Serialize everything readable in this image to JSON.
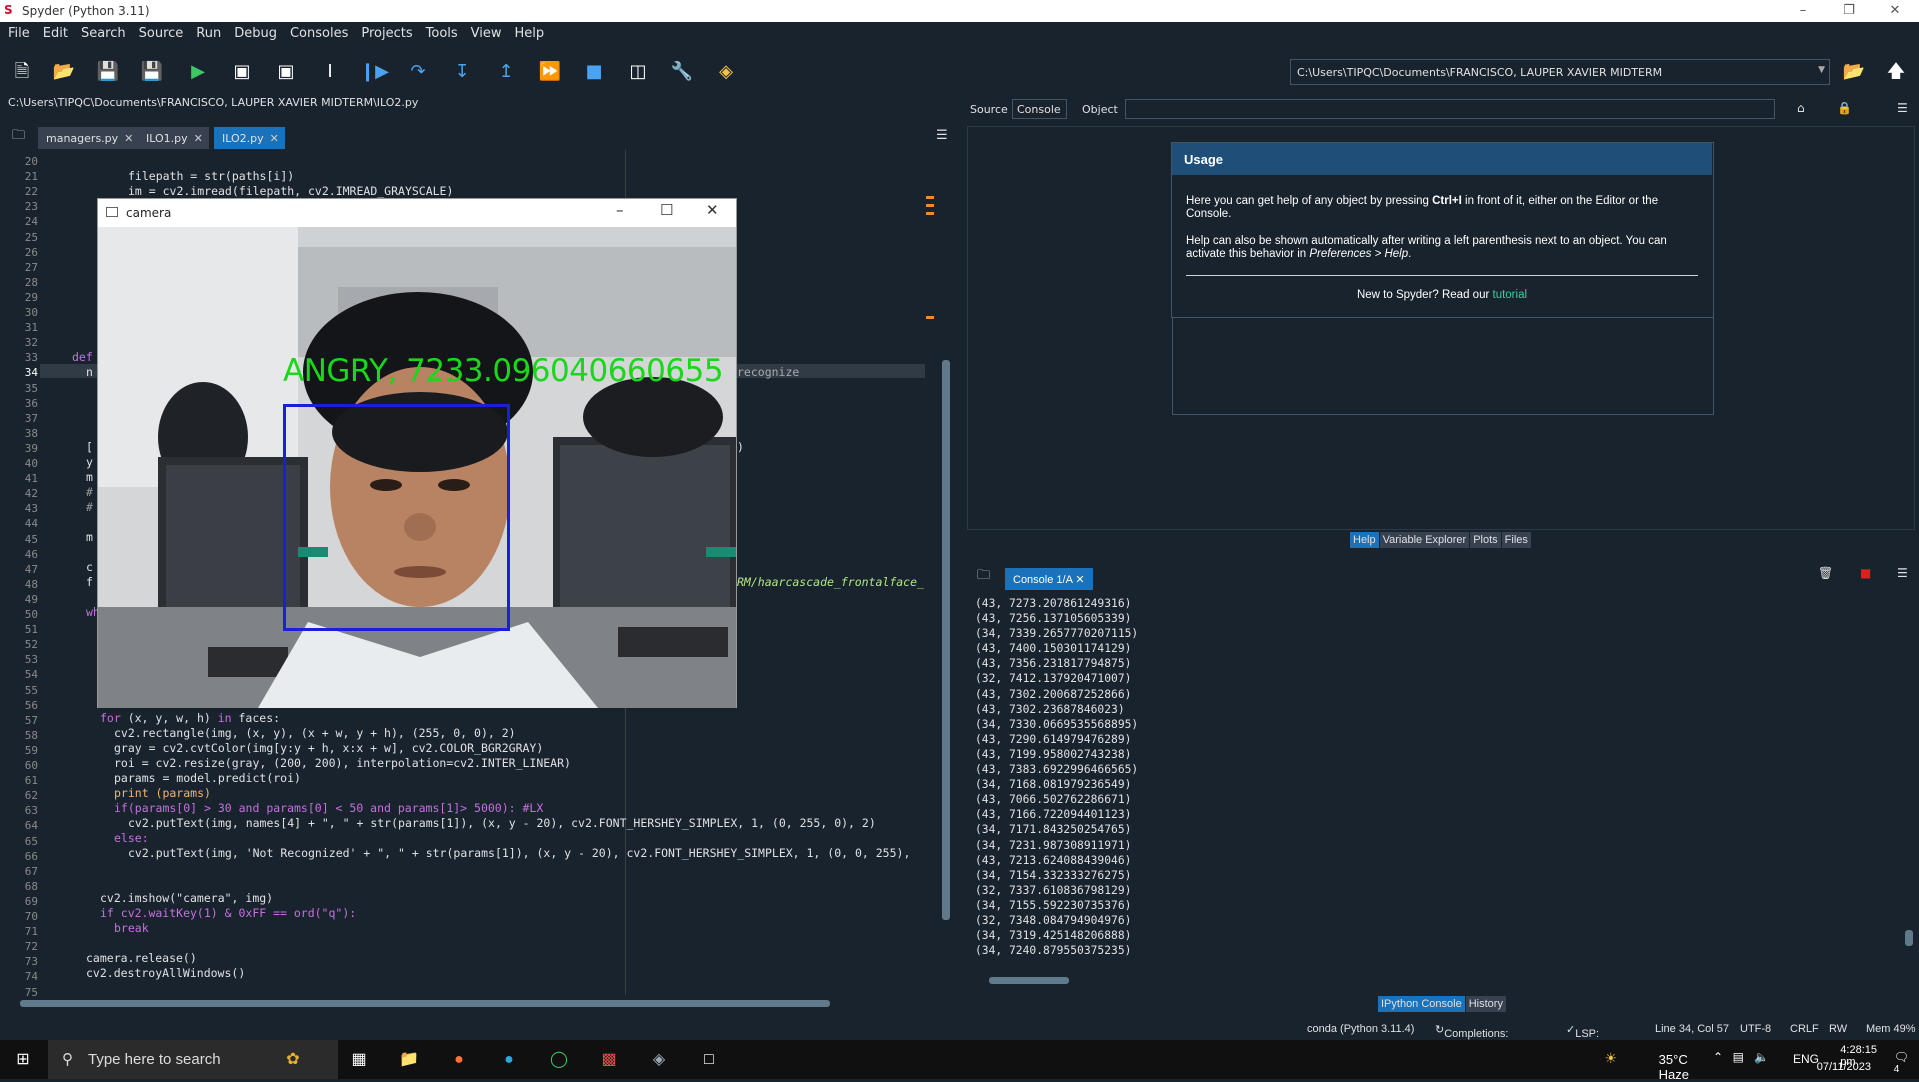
{
  "window": {
    "title": "Spyder (Python 3.11)",
    "minimize": "–",
    "restore": "❐",
    "close": "✕"
  },
  "menu": [
    "File",
    "Edit",
    "Search",
    "Source",
    "Run",
    "Debug",
    "Consoles",
    "Projects",
    "Tools",
    "View",
    "Help"
  ],
  "toolbar": {
    "path": "C:\\Users\\TIPQC\\Documents\\FRANCISCO, LAUPER XAVIER MIDTERM"
  },
  "editor": {
    "filepath": "C:\\Users\\TIPQC\\Documents\\FRANCISCO, LAUPER XAVIER MIDTERM\\ILO2.py",
    "tabs": [
      {
        "label": "managers.py"
      },
      {
        "label": "ILO1.py"
      },
      {
        "label": "ILO2.py"
      }
    ],
    "line_numbers": [
      "20",
      "21",
      "22",
      "23",
      "24",
      "25",
      "26",
      "27",
      "28",
      "29",
      "30",
      "31",
      "32",
      "33",
      "34",
      "35",
      "36",
      "37",
      "38",
      "39",
      "40",
      "41",
      "42",
      "43",
      "44",
      "45",
      "46",
      "47",
      "48",
      "49",
      "50",
      "51",
      "52",
      "53",
      "54",
      "55",
      "56",
      "57",
      "58",
      "59",
      "60",
      "61",
      "62",
      "63",
      "64",
      "65",
      "66",
      "67",
      "68",
      "69",
      "70",
      "71",
      "72",
      "73",
      "74",
      "75"
    ],
    "visible_fragments": {
      "l21": "filepath = str(paths[i])",
      "l22": "im = cv2.imread(filepath, cv2.IMREAD_GRAYSCALE)",
      "l33": "def",
      "l34": "n",
      "l34_right": "recognize",
      "l39": "[",
      "l39_right": ")",
      "l40": "y",
      "l41": "m",
      "l42": "#",
      "l43": "#",
      "l45": "m",
      "l47": "c",
      "l48": "f",
      "l48_right": "RM/haarcascade_frontalface_",
      "l50": "wh",
      "l57": "for (x, y, w, h) in faces:",
      "l58": "cv2.rectangle(img, (x, y), (x + w, y + h), (255, 0, 0), 2)",
      "l59": "gray = cv2.cvtColor(img[y:y + h, x:x + w], cv2.COLOR_BGR2GRAY)",
      "l60": "roi = cv2.resize(gray, (200, 200), interpolation=cv2.INTER_LINEAR)",
      "l61": "params = model.predict(roi)",
      "l62": "print (params)",
      "l63": "if(params[0] > 30 and params[0] < 50 and params[1]> 5000): #LX",
      "l64": "cv2.putText(img, names[4] + \", \" + str(params[1]), (x, y - 20), cv2.FONT_HERSHEY_SIMPLEX, 1, (0, 255, 0), 2)",
      "l65": "else:",
      "l66": "cv2.putText(img, 'Not Recognized' + \", \" + str(params[1]), (x, y - 20), cv2.FONT_HERSHEY_SIMPLEX, 1, (0, 0, 255),",
      "l69": "cv2.imshow(\"camera\", img)",
      "l70": "if cv2.waitKey(1) & 0xFF == ord(\"q\"):",
      "l71": "break",
      "l73": "camera.release()",
      "l74": "cv2.destroyAllWindows()"
    }
  },
  "camera_window": {
    "title": "camera",
    "overlay_label": "ANGRY, 7233.096040660655"
  },
  "help": {
    "source_label": "Source",
    "source_value": "Console",
    "object_label": "Object",
    "usage_title": "Usage",
    "usage_p1_a": "Here you can get help of any object by pressing ",
    "usage_p1_key": "Ctrl+I",
    "usage_p1_b": " in front of it, either on the Editor or the Console.",
    "usage_p2_a": "Help can also be shown automatically after writing a left parenthesis next to an object. You can activate this behavior in ",
    "usage_p2_pref": "Preferences > Help",
    "usage_p2_b": ".",
    "usage_new": "New to Spyder? Read our ",
    "usage_link": "tutorial",
    "pane_tabs": [
      "Help",
      "Variable Explorer",
      "Plots",
      "Files"
    ]
  },
  "console": {
    "tab_label": "Console 1/A",
    "lines": [
      "(43, 7273.207861249316)",
      "(43, 7256.137105605339)",
      "(34, 7339.2657770207115)",
      "(43, 7400.150301174129)",
      "(43, 7356.231817794875)",
      "(32, 7412.137920471007)",
      "(43, 7302.200687252866)",
      "(43, 7302.23687846023)",
      "(34, 7330.0669535568895)",
      "(43, 7290.614979476289)",
      "(43, 7199.958002743238)",
      "(43, 7383.6922996466565)",
      "(34, 7168.081979236549)",
      "(43, 7066.502762286671)",
      "(43, 7166.722094401123)",
      "(34, 7171.843250254765)",
      "(34, 7231.987308911971)",
      "(43, 7213.624088439046)",
      "(34, 7154.332333276275)",
      "(32, 7337.610836798129)",
      "(34, 7155.592230735376)",
      "(32, 7348.084794904976)",
      "(34, 7319.425148206888)",
      "(34, 7240.879550375235)"
    ],
    "pane_tabs": [
      "IPython Console",
      "History"
    ]
  },
  "statusbar": {
    "env": "conda (Python 3.11.4)",
    "completions": "Completions: conda",
    "lsp": "LSP: Python",
    "position": "Line 34, Col 57",
    "encoding": "UTF-8",
    "eol": "CRLF",
    "rw": "RW",
    "mem": "Mem 49%"
  },
  "taskbar": {
    "search_placeholder": "Type here to search",
    "weather": "35°C  Haze",
    "lang": "ENG",
    "time": "4:28:15 pm",
    "date": "07/11/2023",
    "notif_count": "4"
  },
  "colors": {
    "accent": "#1a72bb",
    "label_green": "#1bd61b",
    "box_blue": "#1a20d8"
  }
}
